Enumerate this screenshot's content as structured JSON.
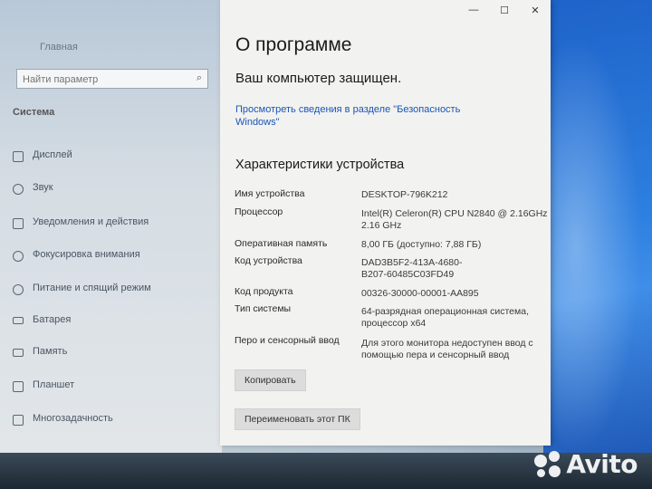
{
  "left_pane": {
    "top_label": "Главная",
    "search_placeholder": "Найти параметр",
    "section_label": "Система",
    "items": [
      {
        "label": "Дисплей"
      },
      {
        "label": "Звук"
      },
      {
        "label": "Уведомления и действия"
      },
      {
        "label": "Фокусировка внимания"
      },
      {
        "label": "Питание и спящий режим"
      },
      {
        "label": "Батарея"
      },
      {
        "label": "Память"
      },
      {
        "label": "Планшет"
      },
      {
        "label": "Многозадачность"
      }
    ]
  },
  "window": {
    "controls": {
      "minimize": "—",
      "maximize": "☐",
      "close": "✕"
    },
    "title": "О программе",
    "protected_text": "Ваш компьютер защищен.",
    "security_link": "Просмотреть сведения в разделе \"Безопасность Windows\"",
    "section_title": "Характеристики устройства",
    "specs": [
      {
        "label": "Имя устройства",
        "value": "DESKTOP-796K212"
      },
      {
        "label": "Процессор",
        "value": "Intel(R) Celeron(R) CPU  N2840  @ 2.16GHz   2.16 GHz"
      },
      {
        "label": "Оперативная память",
        "value": "8,00 ГБ (доступно: 7,88 ГБ)"
      },
      {
        "label": "Код устройства",
        "value": "DAD3B5F2-413A-4680-B207-60485C03FD49"
      },
      {
        "label": "Код продукта",
        "value": "00326-30000-00001-AA895"
      },
      {
        "label": "Тип системы",
        "value": "64-разрядная операционная система, процессор x64"
      },
      {
        "label": "Перо и сенсорный ввод",
        "value": "Для этого монитора недоступен ввод с помощью пера и сенсорный ввод"
      }
    ],
    "copy_button": "Копировать",
    "rename_button": "Переименовать этот ПК"
  },
  "watermark": {
    "text": "Avito"
  },
  "colors": {
    "link": "#1a55b4",
    "window_bg": "#f2f2f0",
    "wallpaper": "#2d7fe0"
  }
}
